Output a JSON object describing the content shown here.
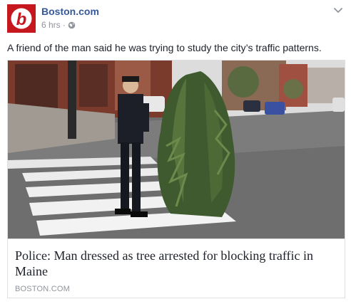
{
  "post": {
    "page_name": "Boston.com",
    "timestamp": "6 hrs",
    "privacy_icon": "globe-icon",
    "caption": "A friend of the man said he was trying to study the city’s traffic patterns.",
    "avatar_letter": "b"
  },
  "link_preview": {
    "headline": "Police: Man dressed as tree arrested for blocking traffic in Maine",
    "domain": "BOSTON.COM"
  },
  "colors": {
    "brand_red": "#c7171e",
    "link_blue": "#365899",
    "meta_gray": "#90949c"
  }
}
